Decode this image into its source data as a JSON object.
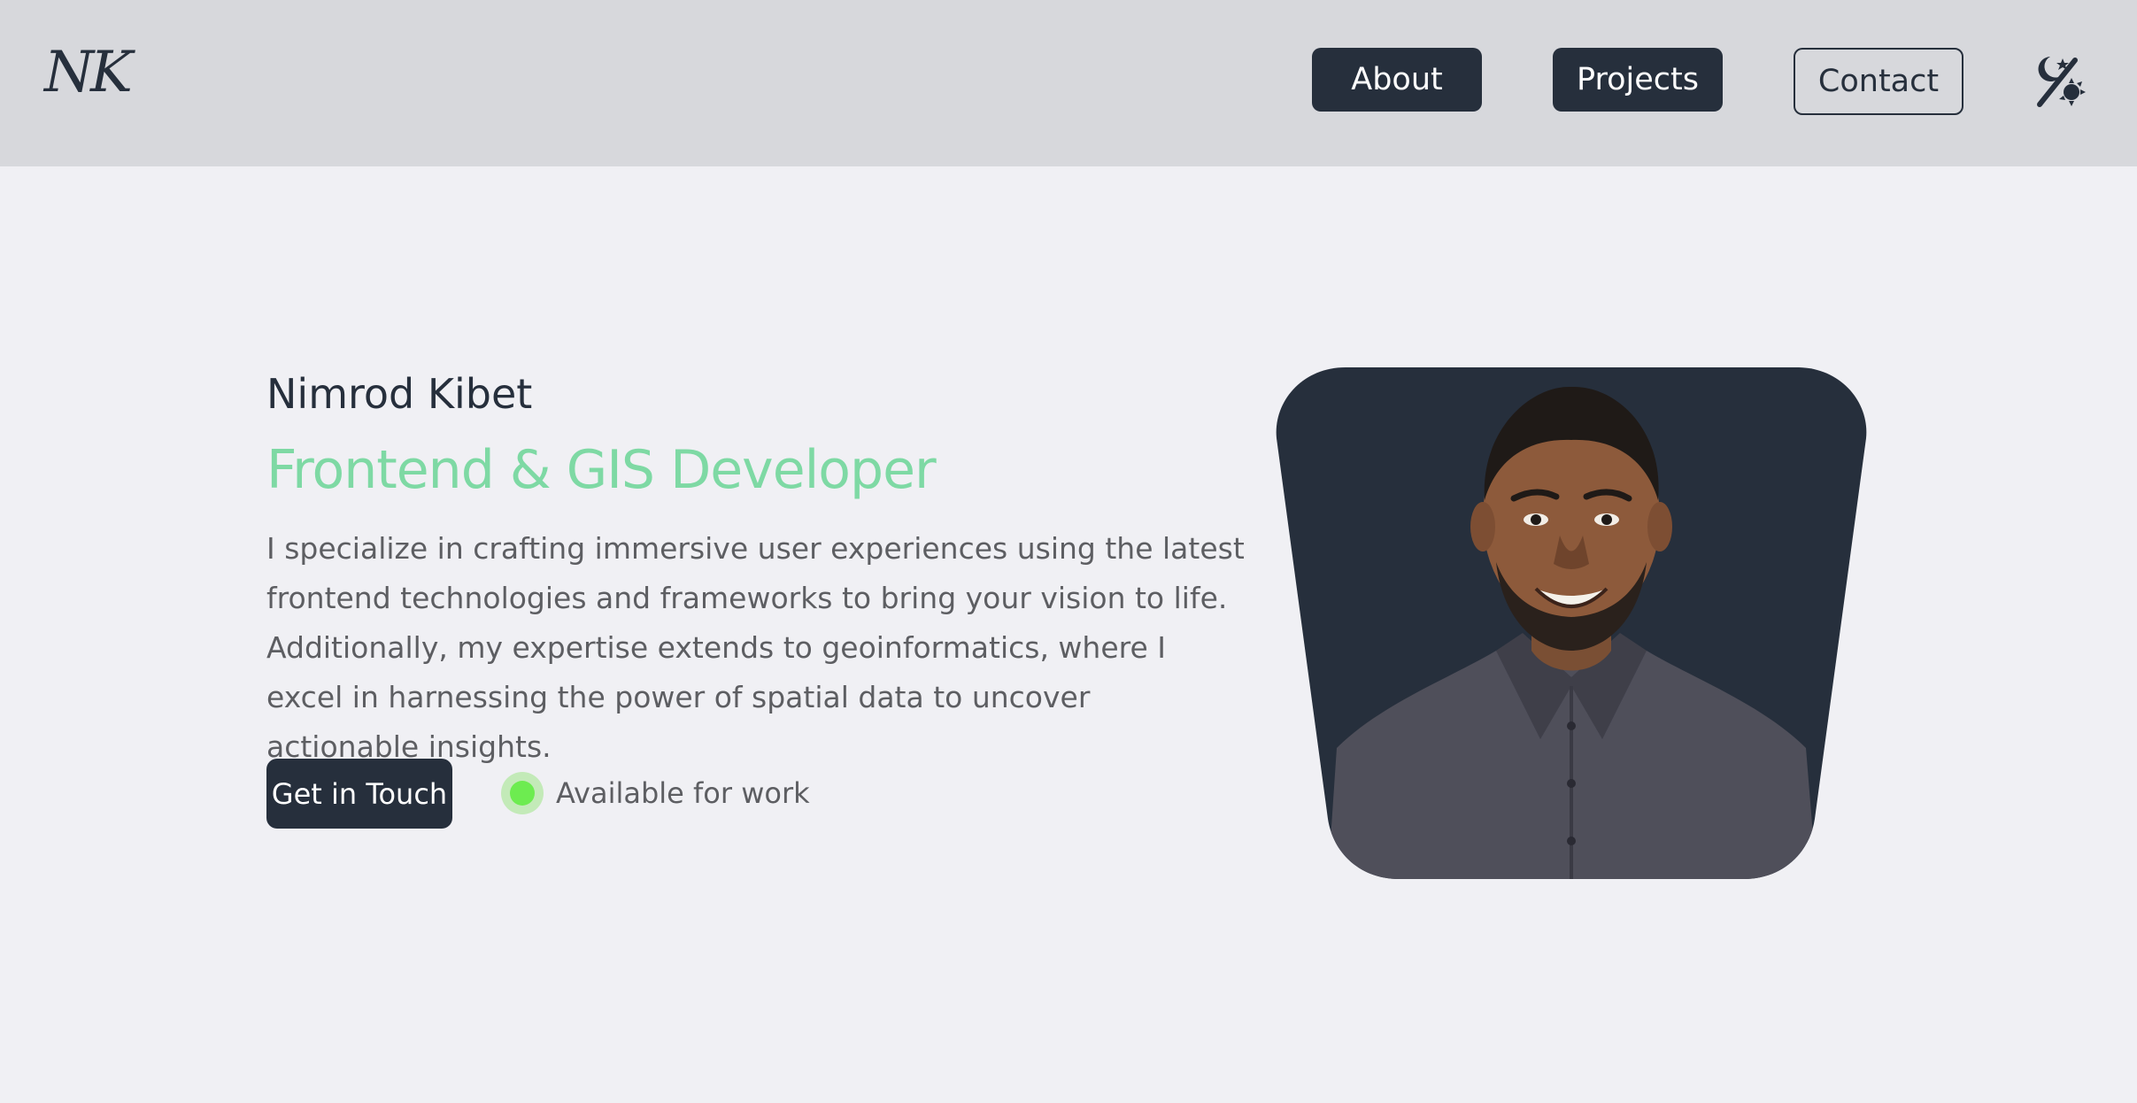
{
  "header": {
    "logo_text": "NK",
    "nav": [
      {
        "label": "About",
        "style": "solid"
      },
      {
        "label": "Projects",
        "style": "solid"
      },
      {
        "label": "Contact",
        "style": "outline"
      }
    ],
    "theme_toggle_icon": "theme-toggle-icon"
  },
  "hero": {
    "name": "Nimrod Kibet",
    "role": "Frontend & GIS Developer",
    "bio": "I specialize in crafting immersive user experiences using the latest frontend technologies and frameworks to bring your vision to life. Additionally, my expertise extends to geoinformatics, where I excel in harnessing the power of spatial data to uncover actionable insights.",
    "cta_label": "Get in Touch",
    "status_text": "Available for work"
  },
  "colors": {
    "header_bg": "#d7d8dc",
    "page_bg": "#f0f0f4",
    "primary_dark": "#262f3c",
    "accent_green": "#7ed9a4",
    "status_green": "#6dec50",
    "body_text": "#5d5e62"
  }
}
